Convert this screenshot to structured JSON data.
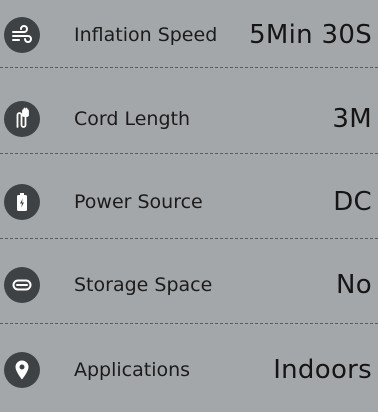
{
  "specs": {
    "items": [
      {
        "label": "Inflation Speed",
        "value": "5Min 30S",
        "icon": "wind-icon"
      },
      {
        "label": "Cord Length",
        "value": "3M",
        "icon": "plug-cord-icon"
      },
      {
        "label": "Power Source",
        "value": "DC",
        "icon": "battery-icon"
      },
      {
        "label": "Storage Space",
        "value": "No",
        "icon": "storage-icon"
      },
      {
        "label": "Applications",
        "value": "Indoors",
        "icon": "location-pin-icon"
      }
    ]
  },
  "colors": {
    "background": "#a4a7aa",
    "icon_circle": "#3f4244",
    "icon_glyph": "#ffffff",
    "text": "#1a1a1a"
  }
}
